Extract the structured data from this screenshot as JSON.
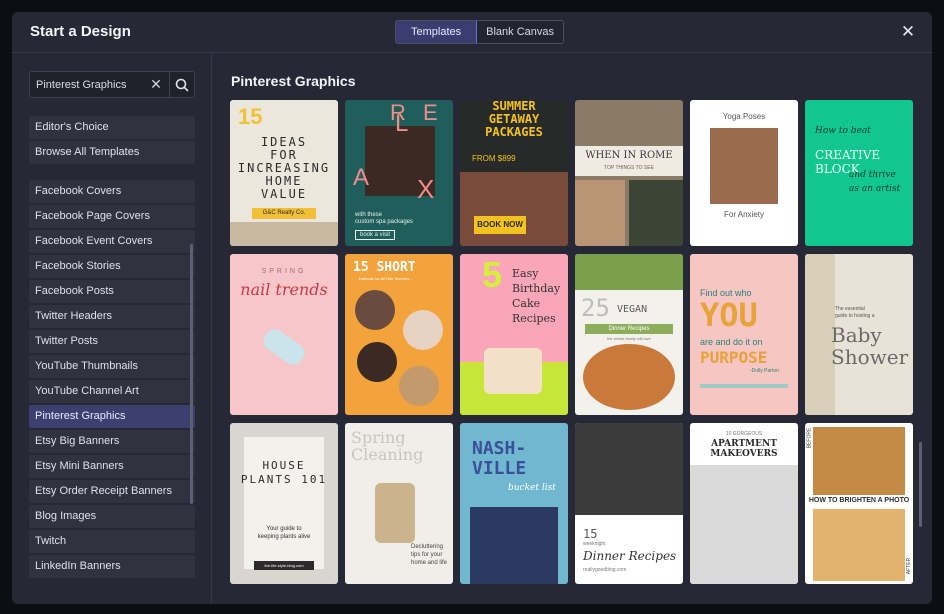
{
  "header": {
    "title": "Start a Design",
    "tabs": [
      {
        "label": "Templates",
        "active": true
      },
      {
        "label": "Blank Canvas",
        "active": false
      }
    ],
    "close_icon": "close-icon"
  },
  "search": {
    "value": "Pinterest Graphics",
    "clear_icon": "clear-icon",
    "search_icon": "search-icon"
  },
  "sidebar": {
    "top_items": [
      "Editor's Choice",
      "Browse All Templates"
    ],
    "categories": [
      "Facebook Covers",
      "Facebook Page Covers",
      "Facebook Event Covers",
      "Facebook Stories",
      "Facebook Posts",
      "Twitter Headers",
      "Twitter Posts",
      "YouTube Thumbnails",
      "YouTube Channel Art",
      "Pinterest Graphics",
      "Etsy Big Banners",
      "Etsy Mini Banners",
      "Etsy Order Receipt Banners",
      "Blog Images",
      "Twitch",
      "LinkedIn Banners"
    ],
    "selected": "Pinterest Graphics"
  },
  "main": {
    "title": "Pinterest Graphics"
  },
  "templates": {
    "t1": {
      "num": "15",
      "line1": "IDEAS",
      "line2": "FOR",
      "line3": "INCREASING",
      "line4": "HOME",
      "line5": "VALUE",
      "tag": "G&C Realty Co."
    },
    "t2": {
      "l1": "R",
      "l2": "E",
      "l3": "L",
      "l4": "A",
      "l5": "X",
      "sub1": "with these",
      "sub2": "custom spa packages",
      "cta": "book a visit"
    },
    "t3": {
      "l1": "SUMMER",
      "l2": "GETAWAY",
      "l3": "PACKAGES",
      "price": "FROM $899",
      "cta": "BOOK NOW"
    },
    "t4": {
      "title": "WHEN IN ROME",
      "sub": "TOP THINGS TO SEE"
    },
    "t5": {
      "title": "Yoga Poses",
      "sub": "For Anxiety"
    },
    "t6": {
      "l1": "How to beat",
      "l2": "CREATIVE BLOCK",
      "l3": "and thrive",
      "l4": "as an artist"
    },
    "t7": {
      "l1": "SPRING",
      "l2": "nail trends"
    },
    "t8": {
      "l1": "15 SHORT",
      "l2": "Haircuts for All Hair Textures"
    },
    "t9": {
      "num": "5",
      "l1": "Easy",
      "l2": "Birthday",
      "l3": "Cake",
      "l4": "Recipes"
    },
    "t10": {
      "num": "25",
      "l1": "VEGAN",
      "l2": "Dinner Recipes",
      "l3": "the whole family will love"
    },
    "t11": {
      "l1": "Find out who",
      "l2": "YOU",
      "l3": "are and do it on",
      "l4": "PURPOSE",
      "l5": "-Dolly Parton"
    },
    "t12": {
      "l1": "The essential",
      "l2": "guide to hosting a",
      "l3": "Baby",
      "l4": "Shower"
    },
    "t13": {
      "l1": "HOUSE",
      "l2": "PLANTS 101",
      "l3": "Your guide to",
      "l4": "keeping plants alive",
      "tag": "the-life-style-blog.com"
    },
    "t14": {
      "l1": "Spring",
      "l2": "Cleaning",
      "side": "the-life-style-blog.com",
      "l3": "Decluttering",
      "l4": "tips for your",
      "l5": "home and life"
    },
    "t15": {
      "l1": "NASH-",
      "l2": "VILLE",
      "l3": "bucket list"
    },
    "t16": {
      "num": "15",
      "l1": "weeknight",
      "l2": "Dinner Recipes",
      "l3": "reallygoodblog.com"
    },
    "t17": {
      "l1": "10 GORGEOUS",
      "l2": "APARTMENT",
      "l3": "MAKEOVERS"
    },
    "t18": {
      "l1": "HOW TO BRIGHTEN A PHOTO",
      "before": "BEFORE",
      "after": "AFTER"
    }
  }
}
